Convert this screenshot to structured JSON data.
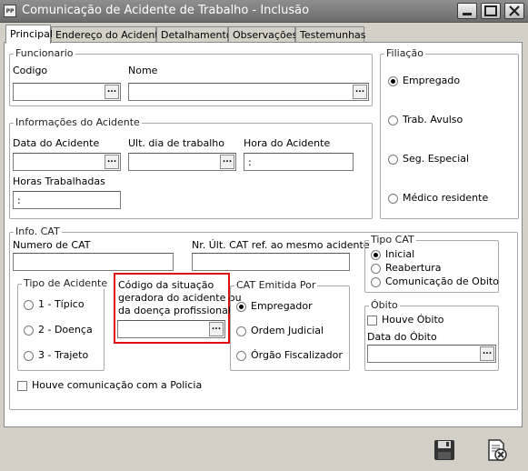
{
  "window": {
    "title": "Comunicação de Acidente de Trabalho - Inclusão",
    "app_icon_text": "PP"
  },
  "tabs": [
    "Principal",
    "Endereço do Acidente",
    "Detalhamento",
    "Observações",
    "Testemunhas"
  ],
  "funcionario": {
    "title": "Funcionario",
    "codigo_label": "Codigo",
    "nome_label": "Nome",
    "codigo_value": "",
    "nome_value": ""
  },
  "filiacao": {
    "title": "Filiação",
    "options": [
      "Empregado",
      "Trab. Avulso",
      "Seg. Especial",
      "Médico residente"
    ],
    "selected": "Empregado"
  },
  "info_acidente": {
    "title": "Informações do Acidente",
    "data_label": "Data do Acidente",
    "ult_dia_label": "Ult. dia de trabalho",
    "hora_label": "Hora do Acidente",
    "hora_value": ":",
    "horas_label": "Horas Trabalhadas",
    "horas_value": ":"
  },
  "info_cat": {
    "title": "Info. CAT",
    "numero_label": "Numero de CAT",
    "nr_ult_label": "Nr. Últ. CAT ref. ao mesmo acidente",
    "tipo_acidente": {
      "title": "Tipo de Acidente",
      "options": [
        "1 - Típico",
        "2 - Doença",
        "3 - Trajeto"
      ]
    },
    "codigo_situacao": {
      "label_lines": [
        "Código da situação",
        "geradora do acidente ou",
        "da doença profissional"
      ]
    },
    "cat_emitida": {
      "title": "CAT Emitida Por",
      "options": [
        "Empregador",
        "Ordem Judicial",
        "Órgão Fiscalizador"
      ],
      "selected": "Empregador"
    },
    "tipo_cat": {
      "title": "Tipo CAT",
      "options": [
        "Inicial",
        "Reabertura",
        "Comunicação de Obito"
      ],
      "selected": "Inicial"
    },
    "obito": {
      "title": "Óbito",
      "houve_label": "Houve Óbito",
      "data_label": "Data do Óbito"
    },
    "policia_label": "Houve comunicação com a Policia"
  },
  "ellipsis": "...",
  "colors": {
    "highlight": "#e01010",
    "titlebar": "#7a7a7a"
  }
}
